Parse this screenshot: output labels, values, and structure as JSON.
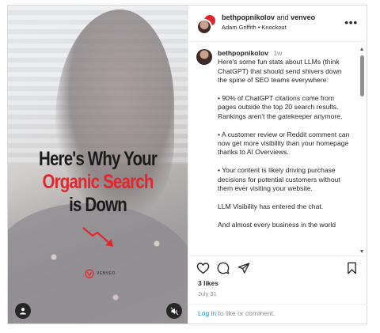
{
  "media": {
    "headline_line1": "Here's Why Your",
    "headline_line2": "Organic Search",
    "headline_line3": "is Down",
    "brand_text": "VENVEO",
    "accent_color": "#e3262d",
    "user_tag_icon": "user-icon",
    "mute_icon": "muted-speaker-icon"
  },
  "header": {
    "author": "bethpopnikolov",
    "joiner": "and",
    "collaborator": "venveo",
    "audio": "Adam Griffith • Knockout",
    "more_icon": "more-options-icon",
    "more_glyph": "•••"
  },
  "caption": {
    "username": "bethpopnikolov",
    "time": "1w",
    "paragraphs": [
      "Here's some fun stats about LLMs (think ChatGPT) that should send shivers down the spine of SEO teams everywhere:",
      "• 90% of ChatGPT citations come from pages outside the top 20 search results. Rankings aren't the gatekeeper anymore.",
      "• A customer review or Reddit comment can now get more visibility than your homepage thanks to AI Overviews.",
      "• Your content is likely driving purchase decisions for potential customers without them ever visiting your website.",
      "LLM Visibility has entered the chat.",
      "And almost every business in the world"
    ]
  },
  "actions": {
    "like_icon": "heart-icon",
    "comment_icon": "comment-icon",
    "share_icon": "share-icon",
    "save_icon": "bookmark-icon"
  },
  "likes": "3 likes",
  "date": "July 31",
  "login": {
    "link": "Log in",
    "rest": " to like or comment."
  }
}
